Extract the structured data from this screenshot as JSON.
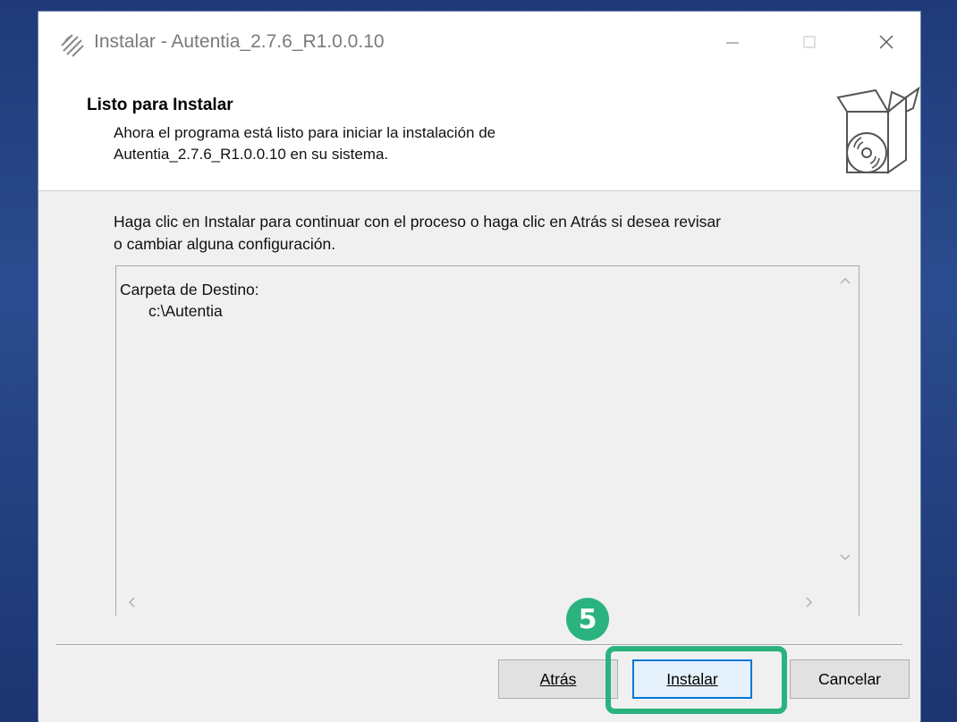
{
  "window": {
    "title": "Instalar - Autentia_2.7.6_R1.0.0.10",
    "app_icon": "installer-logo-icon"
  },
  "header": {
    "title": "Listo para Instalar",
    "description_line1": "Ahora el programa está listo para iniciar la instalación de",
    "description_line2": "Autentia_2.7.6_R1.0.0.10 en su sistema.",
    "icon": "package-disc-icon"
  },
  "content": {
    "instruction_line1": "Haga clic en Instalar para continuar con el proceso o haga clic en Atrás si desea revisar",
    "instruction_line2": "o cambiar alguna configuración.",
    "summary": {
      "label": "Carpeta de Destino:",
      "value": "c:\\Autentia"
    }
  },
  "buttons": {
    "back": "Atrás",
    "install": "Instalar",
    "cancel": "Cancelar"
  },
  "annotation": {
    "step_number": "5",
    "color": "#2bb37f"
  },
  "colors": {
    "focus_border": "#0078d7",
    "annotation": "#2bb37f"
  }
}
